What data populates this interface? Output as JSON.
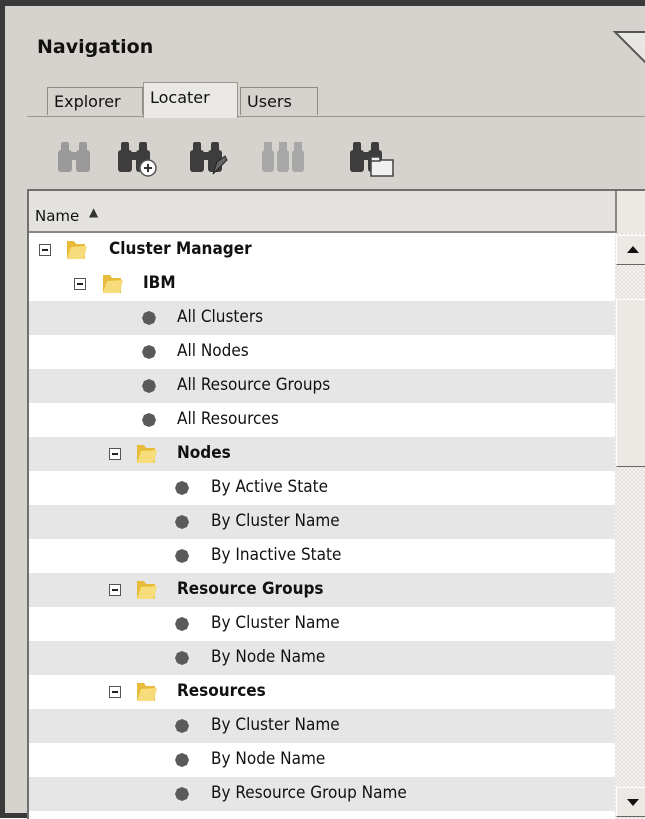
{
  "panel": {
    "title": "Navigation"
  },
  "tabs": [
    {
      "label": "Explorer",
      "active": false
    },
    {
      "label": "Locater",
      "active": true
    },
    {
      "label": "Users",
      "active": false
    }
  ],
  "toolbar": {
    "buttons": [
      {
        "icon": "binoculars-icon",
        "enabled": false
      },
      {
        "icon": "binoculars-add-icon",
        "enabled": true
      },
      {
        "icon": "binoculars-edit-icon",
        "enabled": true
      },
      {
        "icon": "binoculars-multi-icon",
        "enabled": false
      },
      {
        "icon": "binoculars-folder-icon",
        "enabled": true
      }
    ]
  },
  "tree": {
    "column_header": "Name",
    "sort": "ascending",
    "rows": [
      {
        "label": "Cluster Manager",
        "type": "folder",
        "level": 0,
        "expanded": true
      },
      {
        "label": "IBM",
        "type": "folder",
        "level": 1,
        "expanded": true
      },
      {
        "label": "All Clusters",
        "type": "item",
        "level": 2
      },
      {
        "label": "All Nodes",
        "type": "item",
        "level": 2
      },
      {
        "label": "All Resource Groups",
        "type": "item",
        "level": 2
      },
      {
        "label": "All Resources",
        "type": "item",
        "level": 2
      },
      {
        "label": "Nodes",
        "type": "folder",
        "level": 2,
        "expanded": true
      },
      {
        "label": "By Active State",
        "type": "item",
        "level": 3
      },
      {
        "label": "By Cluster Name",
        "type": "item",
        "level": 3
      },
      {
        "label": "By Inactive State",
        "type": "item",
        "level": 3
      },
      {
        "label": "Resource Groups",
        "type": "folder",
        "level": 2,
        "expanded": true
      },
      {
        "label": "By Cluster Name",
        "type": "item",
        "level": 3
      },
      {
        "label": "By Node Name",
        "type": "item",
        "level": 3
      },
      {
        "label": "Resources",
        "type": "folder",
        "level": 2,
        "expanded": true
      },
      {
        "label": "By Cluster Name",
        "type": "item",
        "level": 3
      },
      {
        "label": "By Node Name",
        "type": "item",
        "level": 3
      },
      {
        "label": "By Resource Group Name",
        "type": "item",
        "level": 3
      }
    ]
  },
  "colors": {
    "panel_bg": "#d6d3ce",
    "row_alt": "#e6e6e6",
    "folder": "#f2cf63",
    "bullet": "#5a5a5a"
  }
}
